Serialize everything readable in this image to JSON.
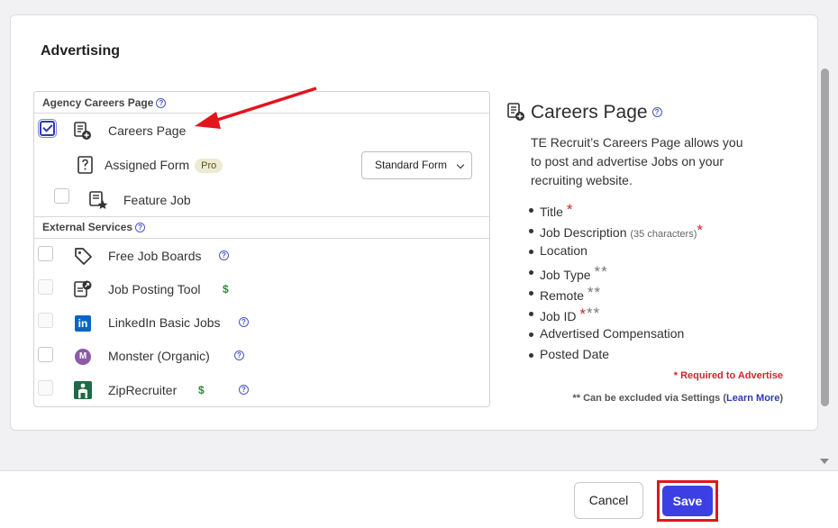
{
  "section": {
    "title": "Advertising"
  },
  "agency": {
    "header": "Agency Careers Page",
    "careers_page": {
      "label": "Careers Page",
      "checked": true,
      "icon": "document-add-icon"
    },
    "assigned_form": {
      "label": "Assigned Form",
      "badge": "Pro",
      "select_value": "Standard Form",
      "icon": "form-question-icon"
    },
    "feature_job": {
      "label": "Feature Job",
      "checked": false,
      "icon": "document-star-icon"
    }
  },
  "external": {
    "header": "External Services",
    "items": [
      {
        "label": "Free Job Boards",
        "icon": "tag-icon",
        "help": true,
        "paid": false
      },
      {
        "label": "Job Posting Tool",
        "icon": "external-post-icon",
        "help": false,
        "paid": true,
        "paid_symbol": "$"
      },
      {
        "label": "LinkedIn Basic Jobs",
        "icon": "linkedin-icon",
        "icon_text": "in",
        "help": true,
        "paid": false
      },
      {
        "label": "Monster (Organic)",
        "icon": "monster-icon",
        "icon_text": "M",
        "help": true,
        "paid": false
      },
      {
        "label": "ZipRecruiter",
        "icon": "ziprecruiter-icon",
        "help": true,
        "paid": true,
        "paid_symbol": "$"
      }
    ]
  },
  "info": {
    "title": "Careers Page",
    "description": "TE Recruit’s Careers Page allows you to post and advertise Jobs on your recruiting website.",
    "fields": [
      {
        "label": "Title",
        "marker": "*",
        "note": ""
      },
      {
        "label": "Job Description",
        "marker": "*",
        "note": "(35 characters)"
      },
      {
        "label": "Location",
        "marker": "",
        "note": ""
      },
      {
        "label": "Job Type",
        "marker": "**",
        "note": ""
      },
      {
        "label": "Remote",
        "marker": "**",
        "note": ""
      },
      {
        "label": "Job ID",
        "marker": "***",
        "note": ""
      },
      {
        "label": "Advertised Compensation",
        "marker": "",
        "note": ""
      },
      {
        "label": "Posted Date",
        "marker": "",
        "note": ""
      }
    ],
    "required_note": "* Required to Advertise",
    "exclude_note_prefix": "** Can be excluded via Settings (",
    "exclude_note_link": "Learn More",
    "exclude_note_suffix": ")"
  },
  "footer": {
    "cancel_label": "Cancel",
    "save_label": "Save"
  },
  "colors": {
    "accent": "#3c3fe4",
    "highlight": "#e0161f",
    "required": "#d0262b",
    "paid": "#2c8a3c"
  }
}
